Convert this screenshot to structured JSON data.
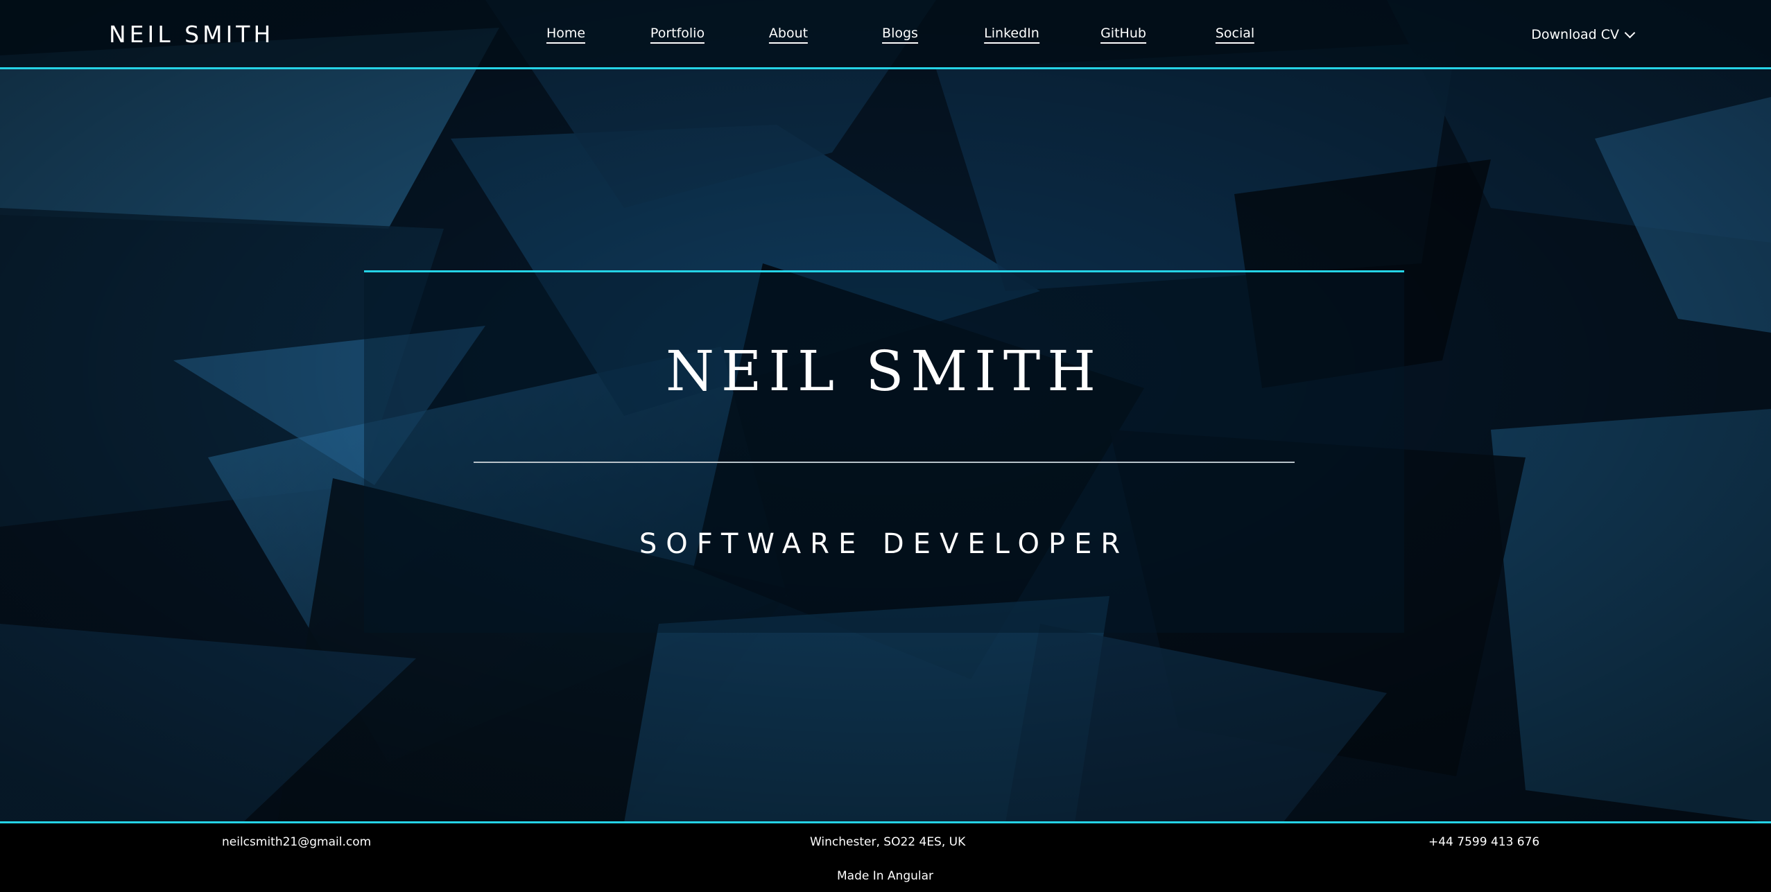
{
  "header": {
    "brand": "NEIL SMITH",
    "nav": [
      {
        "label": "Home"
      },
      {
        "label": "Portfolio"
      },
      {
        "label": "About"
      },
      {
        "label": "Blogs"
      },
      {
        "label": "LinkedIn"
      },
      {
        "label": "GitHub"
      },
      {
        "label": "Social"
      }
    ],
    "download_label": "Download CV",
    "download_icon": "chevron-down-icon"
  },
  "hero": {
    "title": "NEIL SMITH",
    "subtitle": "SOFTWARE DEVELOPER"
  },
  "footer": {
    "email": "neilcsmith21@gmail.com",
    "address": "Winchester, SO22 4ES, UK",
    "phone": "+44 7599 413 676",
    "made_in": "Made In Angular"
  },
  "colors": {
    "accent": "#25d3e6",
    "background": "#04111d",
    "shape_blue": "#1d5f8f"
  }
}
